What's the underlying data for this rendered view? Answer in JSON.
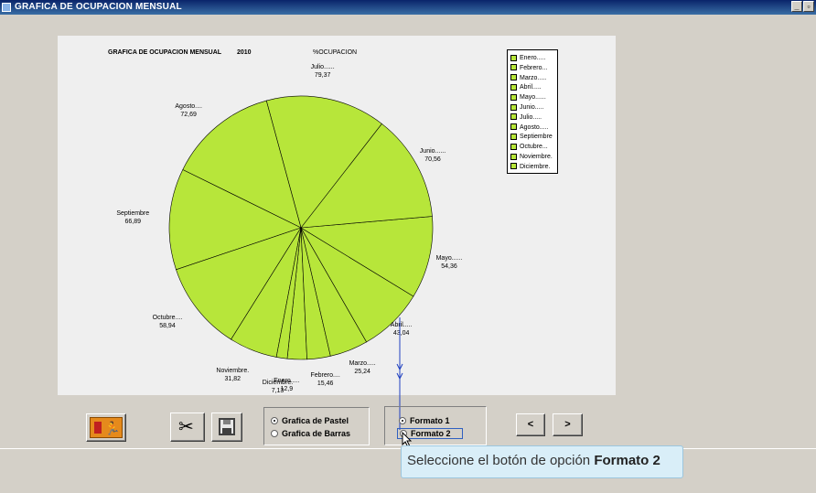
{
  "window": {
    "title": "GRAFICA DE OCUPACION MENSUAL",
    "min_label": "_",
    "restore_label": "▫"
  },
  "chart_data": {
    "type": "pie",
    "title": "GRAFICA DE OCUPACION MENSUAL",
    "year": "2010",
    "subtitle": "%OCUPACION",
    "categories": [
      "Enero",
      "Febrero",
      "Marzo",
      "Abril",
      "Mayo",
      "Junio",
      "Julio",
      "Agosto",
      "Septiembre",
      "Octubre",
      "Noviembre",
      "Diciembre"
    ],
    "values": [
      12.9,
      15.46,
      25.24,
      43.04,
      54.36,
      70.56,
      79.37,
      72.69,
      66.89,
      58.94,
      31.82,
      7.13
    ],
    "labels": [
      {
        "name": "Enero.....",
        "value": "12,9"
      },
      {
        "name": "Febrero....",
        "value": "15,46"
      },
      {
        "name": "Marzo.....",
        "value": "25,24"
      },
      {
        "name": "Abril.....",
        "value": "43,04"
      },
      {
        "name": "Mayo......",
        "value": "54,36"
      },
      {
        "name": "Junio......",
        "value": "70,56"
      },
      {
        "name": "Julio......",
        "value": "79,37"
      },
      {
        "name": "Agosto....",
        "value": "72,69"
      },
      {
        "name": "Septiembre",
        "value": "66,89"
      },
      {
        "name": "Octubre....",
        "value": "58,94"
      },
      {
        "name": "Noviembre.",
        "value": "31,82"
      },
      {
        "name": "Diciembre.",
        "value": "7,13"
      }
    ],
    "legend": [
      "Enero.....",
      "Febrero...",
      "Marzo.....",
      "Abril.....",
      "Mayo......",
      "Junio.....",
      "Julio.....",
      "Agosto.....",
      "Septiembre",
      "Octubre...",
      "Noviembre.",
      "Diciembre."
    ],
    "legend_position": "top-right",
    "color": "#b7e63a"
  },
  "options": {
    "chart_type": [
      "Grafica de Pastel",
      "Grafica de Barras"
    ],
    "chart_type_selected": 0,
    "format": [
      "Formato 1",
      "Formato 2"
    ],
    "format_selected": 0
  },
  "nav": {
    "prev": "<",
    "next": ">"
  },
  "tooltip": {
    "text": "Seleccione el botón de opción ",
    "bold": "Formato 2"
  }
}
